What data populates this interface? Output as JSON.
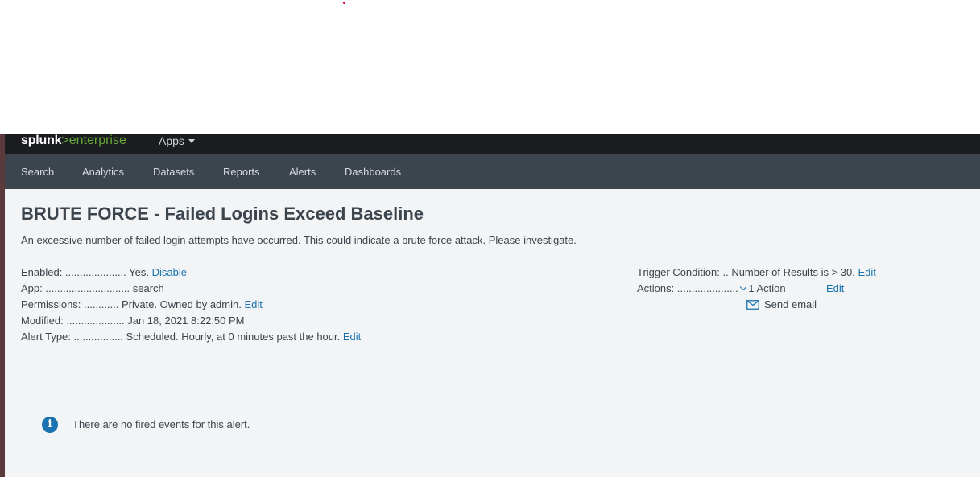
{
  "header": {
    "logo_brand": "splunk",
    "logo_sep": ">",
    "logo_product": "enterprise",
    "apps_label": "Apps"
  },
  "nav": {
    "items": [
      "Search",
      "Analytics",
      "Datasets",
      "Reports",
      "Alerts",
      "Dashboards"
    ]
  },
  "alert": {
    "title": "BRUTE FORCE - Failed Logins Exceed Baseline",
    "description": "An excessive number of failed login attempts have occurred. This could indicate a brute force attack. Please investigate.",
    "enabled_label": "Enabled: .....................",
    "enabled_value": "Yes.",
    "enabled_link": "Disable",
    "app_label": "App: .............................",
    "app_value": "search",
    "permissions_label": "Permissions: ............",
    "permissions_value": "Private. Owned by admin.",
    "permissions_link": "Edit",
    "modified_label": "Modified: ....................",
    "modified_value": "Jan 18, 2021 8:22:50 PM",
    "alert_type_label": "Alert Type: .................",
    "alert_type_value": "Scheduled. Hourly, at 0 minutes past the hour.",
    "alert_type_link": "Edit",
    "trigger_label": "Trigger Condition: ..",
    "trigger_value": "Number of Results is > 30.",
    "trigger_link": "Edit",
    "actions_label": "Actions: .....................",
    "actions_value": "1 Action",
    "actions_link": "Edit",
    "action_item": "Send email"
  },
  "events": {
    "empty_message": "There are no fired events for this alert."
  },
  "colors": {
    "link": "#1a73b0",
    "topbar": "#1a1c20",
    "navbar": "#3c444d",
    "background": "#f2f4f5",
    "brand_green": "#65a637"
  }
}
